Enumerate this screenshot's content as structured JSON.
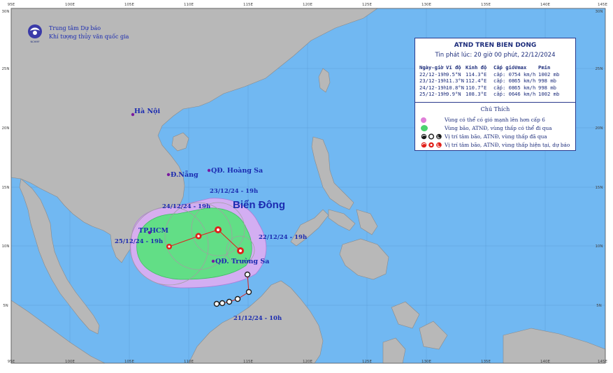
{
  "map": {
    "place_labels": {
      "hanoi": "Hà Nội",
      "danang": "Đ.Nẵng",
      "hoangsa": "QĐ. Hoàng Sa",
      "truongsa": "QĐ. Trường Sa",
      "hcm": "TP.HCM",
      "biendong": "Biển Đông"
    },
    "track_labels": {
      "t2312": "23/12/24 - 19h",
      "t2412": "24/12/24 - 19h",
      "t2512": "25/12/24 - 19h",
      "t2212": "22/12/24 - 19h",
      "t2112": "21/12/24 - 10h"
    },
    "agency": {
      "line1": "Trung tâm Dự báo",
      "line2": "Khí tượng thủy văn quốc gia",
      "logo_text": "NCHMF"
    },
    "longitude_ticks": [
      "95E",
      "100E",
      "105E",
      "110E",
      "115E",
      "120E",
      "125E",
      "130E",
      "135E",
      "140E",
      "145E"
    ],
    "latitude_ticks_left": [
      "30N",
      "25N",
      "20N",
      "15N",
      "10N",
      "5N"
    ],
    "latitude_ticks_right": [
      "30N",
      "25N",
      "20N",
      "15N",
      "10N",
      "5N"
    ],
    "colors": {
      "sea": "#71b8f2",
      "land": "#b8b8b8",
      "zone_wind": "#d6a8f0",
      "zone_storm": "#66e08a",
      "track": "#e0201a"
    }
  },
  "forecast_table": {
    "title": "ATND TREN BIEN DONG",
    "issued": "Tin phát lúc: 20 giờ 00 phút, 22/12/2024",
    "headers": [
      "Ngày-giờ",
      "Vĩ độ",
      "Kinh độ",
      "Cấp gió",
      "Vmax",
      "Pmin"
    ],
    "rows": [
      [
        "22/12-19h",
        "9.5°N",
        "114.3°E",
        "cấp: 07",
        "54 km/h",
        "1002 mb"
      ],
      [
        "23/12-19h",
        "11.3°N",
        "112.4°E",
        "cấp: 08",
        "65 km/h",
        "998 mb"
      ],
      [
        "24/12-19h",
        "10.8°N",
        "110.7°E",
        "cấp: 08",
        "65 km/h",
        "998 mb"
      ],
      [
        "25/12-19h",
        "9.9°N",
        "108.3°E",
        "cấp: 06",
        "46 km/h",
        "1002 mb"
      ]
    ]
  },
  "legend": {
    "title": "Chú Thích",
    "items": [
      "Vùng có thể có gió mạnh lên hơn cấp 6",
      "Vùng bão, ATNĐ, vùng thấp có thể đi qua",
      "Vị trí tâm bão, ATNĐ, vùng thấp đã qua",
      "Vị trí tâm bão, ATNĐ, vùng thấp hiện tại, dự báo"
    ]
  }
}
